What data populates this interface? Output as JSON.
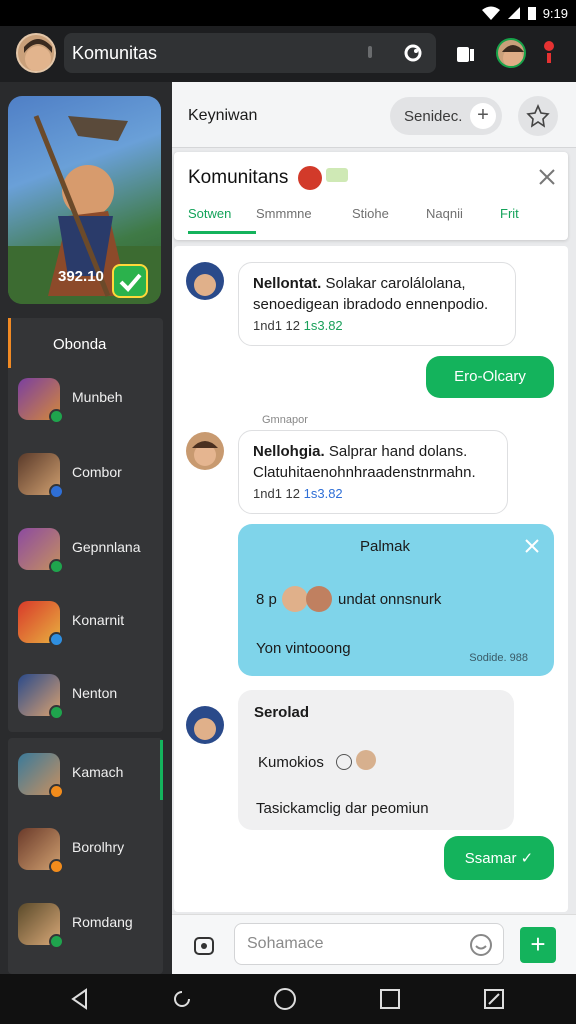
{
  "status": {
    "time": "9:19"
  },
  "topbar": {
    "search_text": "Komunitas"
  },
  "sidebar": {
    "card_text": "392.10",
    "group1_title": "Obonda",
    "items": [
      {
        "label": "Munbeh",
        "icon": "game-icon-purple",
        "badge": "#1fa44d"
      },
      {
        "label": "Combor",
        "icon": "game-icon-pirate",
        "badge": "#2f6fd6"
      },
      {
        "label": "Gepnnlana",
        "icon": "game-icon-warrior",
        "badge": "#1fa44d"
      },
      {
        "label": "Konarnit",
        "icon": "game-icon-red",
        "badge": "#2f8fe0"
      },
      {
        "label": "Nenton",
        "icon": "game-icon-blue",
        "badge": "#1fa44d"
      }
    ],
    "items2": [
      {
        "label": "Kamach",
        "icon": "game-icon-wizard",
        "badge": "#f28c1c"
      },
      {
        "label": "Borolhry",
        "icon": "game-icon-brown",
        "badge": "#f28c1c"
      },
      {
        "label": "Romdang",
        "icon": "game-icon-hunter",
        "badge": "#1fa44d"
      }
    ]
  },
  "header": {
    "title": "Keyniwan",
    "pill": "Senidec."
  },
  "panel": {
    "title": "Komunitans",
    "tabs": [
      "Sotwen",
      "Smmmne",
      "Stiohe",
      "Naqnii",
      "Frit"
    ],
    "active_tab": 0
  },
  "messages": {
    "m1": {
      "name": "Nellontat.",
      "text1": "Solakar carolálolana,",
      "text2": "senoedigean ibradodo ennenpodio.",
      "meta": "1nd1 12",
      "meta_hl": "1s3.82"
    },
    "r1": {
      "text": "Ero-Olcary"
    },
    "tag": "Gmnapor",
    "m2": {
      "name": "Nellohgia.",
      "text1": "Salprar hand dolans.",
      "text2": "Clatuhitaenohnhraadenstnrmahn.",
      "meta": "1nd1 12",
      "meta_hl": "1s3.82"
    },
    "card": {
      "title": "Palmak",
      "mid": "undat onnsnurk",
      "mid_prefix": "8 p",
      "bottom": "Yon vintooong",
      "foot": "Sodide. 988"
    },
    "m3": {
      "name": "Serolad",
      "line1": "Kumokios",
      "line2": "Tasickamclig dar peomiun"
    },
    "r2": {
      "text": "Ssamar ✓"
    }
  },
  "composer": {
    "placeholder": "Sohamace",
    "send": "+"
  },
  "colors": {
    "accent": "#14b35c",
    "card": "#7fd4ea"
  }
}
